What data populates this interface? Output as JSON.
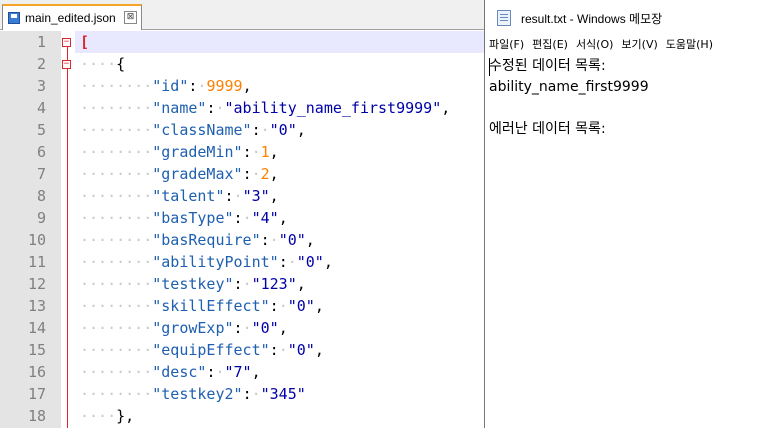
{
  "npp": {
    "tab": {
      "label": "main_edited.json",
      "close": "⊠"
    },
    "lines": [
      {
        "n": "1"
      },
      {
        "n": "2"
      },
      {
        "n": "3"
      },
      {
        "n": "4"
      },
      {
        "n": "5"
      },
      {
        "n": "6"
      },
      {
        "n": "7"
      },
      {
        "n": "8"
      },
      {
        "n": "9"
      },
      {
        "n": "10"
      },
      {
        "n": "11"
      },
      {
        "n": "12"
      },
      {
        "n": "13"
      },
      {
        "n": "14"
      },
      {
        "n": "15"
      },
      {
        "n": "16"
      },
      {
        "n": "17"
      },
      {
        "n": "18"
      }
    ],
    "code": {
      "l1": "[",
      "l2": "{",
      "fields": [
        {
          "key": "\"id\"",
          "value": "9999",
          "type": "num"
        },
        {
          "key": "\"name\"",
          "value": "\"ability_name_first9999\"",
          "type": "str"
        },
        {
          "key": "\"className\"",
          "value": "\"0\"",
          "type": "str"
        },
        {
          "key": "\"gradeMin\"",
          "value": "1",
          "type": "num"
        },
        {
          "key": "\"gradeMax\"",
          "value": "2",
          "type": "num"
        },
        {
          "key": "\"talent\"",
          "value": "\"3\"",
          "type": "str"
        },
        {
          "key": "\"basType\"",
          "value": "\"4\"",
          "type": "str"
        },
        {
          "key": "\"basRequire\"",
          "value": "\"0\"",
          "type": "str"
        },
        {
          "key": "\"abilityPoint\"",
          "value": "\"0\"",
          "type": "str"
        },
        {
          "key": "\"testkey\"",
          "value": "\"123\"",
          "type": "str"
        },
        {
          "key": "\"skillEffect\"",
          "value": "\"0\"",
          "type": "str"
        },
        {
          "key": "\"growExp\"",
          "value": "\"0\"",
          "type": "str"
        },
        {
          "key": "\"equipEffect\"",
          "value": "\"0\"",
          "type": "str"
        },
        {
          "key": "\"desc\"",
          "value": "\"7\"",
          "type": "str"
        },
        {
          "key": "\"testkey2\"",
          "value": "\"345\"",
          "type": "str"
        }
      ],
      "l18": "},"
    },
    "colors": {
      "bracket": "#e0262b",
      "key": "#1e5fb0",
      "string": "#0000a8",
      "number": "#ff8000",
      "tab_accent": "#f4a427"
    }
  },
  "notepad": {
    "title": "result.txt - Windows 메모장",
    "menu": [
      "파일(F)",
      "편집(E)",
      "서식(O)",
      "보기(V)",
      "도움말(H)"
    ],
    "content": "수정된 데이터 목록:\nability_name_first9999\n\n에러난 데이터 목록:"
  }
}
